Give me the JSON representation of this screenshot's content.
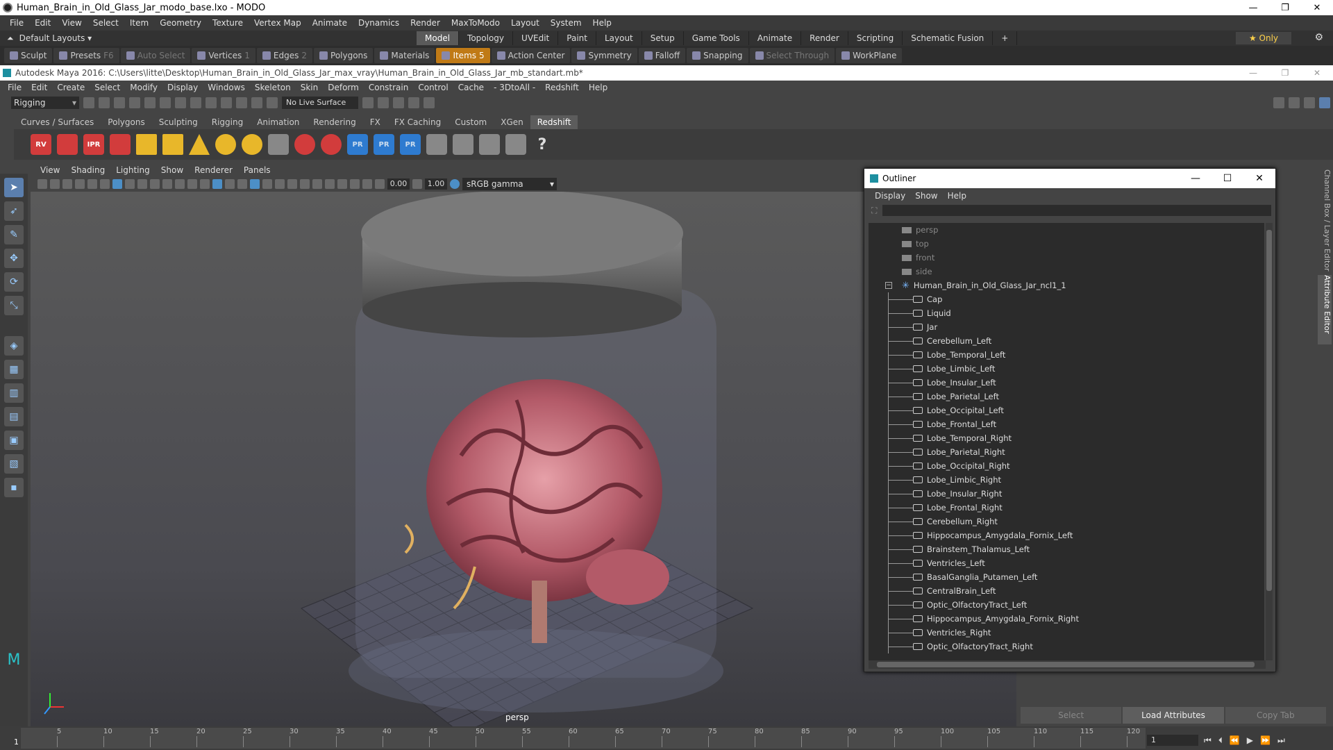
{
  "modo": {
    "title": "Human_Brain_in_Old_Glass_Jar_modo_base.lxo - MODO",
    "menu": [
      "File",
      "Edit",
      "View",
      "Select",
      "Item",
      "Geometry",
      "Texture",
      "Vertex Map",
      "Animate",
      "Dynamics",
      "Render",
      "MaxToModo",
      "Layout",
      "System",
      "Help"
    ],
    "layout_dropdown": "Default Layouts ▾",
    "layout_tabs": [
      "Model",
      "Topology",
      "UVEdit",
      "Paint",
      "Layout",
      "Setup",
      "Game Tools",
      "Animate",
      "Render",
      "Scripting",
      "Schematic Fusion",
      "+"
    ],
    "only_label": "★ Only",
    "toolbar": {
      "sculpt": "Sculpt",
      "presets": "Presets",
      "presets_key": "F6",
      "auto_select": "Auto Select",
      "vertices": "Vertices",
      "vertices_key": "1",
      "edges": "Edges",
      "edges_key": "2",
      "polygons": "Polygons",
      "materials": "Materials",
      "items": "Items",
      "items_key": "5",
      "action_center": "Action Center",
      "symmetry": "Symmetry",
      "falloff": "Falloff",
      "snapping": "Snapping",
      "select_through": "Select Through",
      "workplane": "WorkPlane"
    }
  },
  "maya": {
    "title": "Autodesk Maya 2016: C:\\Users\\litte\\Desktop\\Human_Brain_in_Old_Glass_Jar_max_vray\\Human_Brain_in_Old_Glass_Jar_mb_standart.mb*",
    "menu": [
      "File",
      "Edit",
      "Create",
      "Select",
      "Modify",
      "Display",
      "Windows",
      "Skeleton",
      "Skin",
      "Deform",
      "Constrain",
      "Control",
      "Cache",
      "- 3DtoAll -",
      "Redshift",
      "Help"
    ],
    "mode": "Rigging",
    "live_surface": "No Live Surface",
    "shelf_tabs": [
      "Curves / Surfaces",
      "Polygons",
      "Sculpting",
      "Rigging",
      "Animation",
      "Rendering",
      "FX",
      "FX Caching",
      "Custom",
      "XGen",
      "Redshift"
    ],
    "shelf_icons": [
      "RV",
      "IPR",
      "PR",
      "PR",
      "PR",
      "?"
    ],
    "viewport_menu": [
      "View",
      "Shading",
      "Lighting",
      "Show",
      "Renderer",
      "Panels"
    ],
    "viewport_values": {
      "exposure": "0.00",
      "gamma": "1.00",
      "colorspace": "sRGB gamma"
    },
    "camera_label": "persp",
    "right_buttons": [
      "Select",
      "Load Attributes",
      "Copy Tab"
    ],
    "side_tabs": [
      "Channel Box / Layer Editor",
      "Attribute Editor"
    ]
  },
  "outliner": {
    "title": "Outliner",
    "menu": [
      "Display",
      "Show",
      "Help"
    ],
    "cameras": [
      "persp",
      "top",
      "front",
      "side"
    ],
    "group": "Human_Brain_in_Old_Glass_Jar_ncl1_1",
    "children": [
      "Cap",
      "Liquid",
      "Jar",
      "Cerebellum_Left",
      "Lobe_Temporal_Left",
      "Lobe_Limbic_Left",
      "Lobe_Insular_Left",
      "Lobe_Parietal_Left",
      "Lobe_Occipital_Left",
      "Lobe_Frontal_Left",
      "Lobe_Temporal_Right",
      "Lobe_Parietal_Right",
      "Lobe_Occipital_Right",
      "Lobe_Limbic_Right",
      "Lobe_Insular_Right",
      "Lobe_Frontal_Right",
      "Cerebellum_Right",
      "Hippocampus_Amygdala_Fornix_Left",
      "Brainstem_Thalamus_Left",
      "Ventricles_Left",
      "BasalGanglia_Putamen_Left",
      "CentralBrain_Left",
      "Optic_OlfactoryTract_Left",
      "Hippocampus_Amygdala_Fornix_Right",
      "Ventricles_Right",
      "Optic_OlfactoryTract_Right"
    ]
  },
  "timeline": {
    "ticks": [
      "5",
      "10",
      "15",
      "20",
      "25",
      "30",
      "35",
      "40",
      "45",
      "50",
      "55",
      "60",
      "65",
      "70",
      "75",
      "80",
      "85",
      "90",
      "95",
      "100",
      "105",
      "110",
      "115",
      "120"
    ],
    "start": "1",
    "current_frame": "1"
  },
  "colors": {
    "accent": "#c07a16",
    "maya_blue": "#5b7fae",
    "redshift": "#d23c3c"
  }
}
